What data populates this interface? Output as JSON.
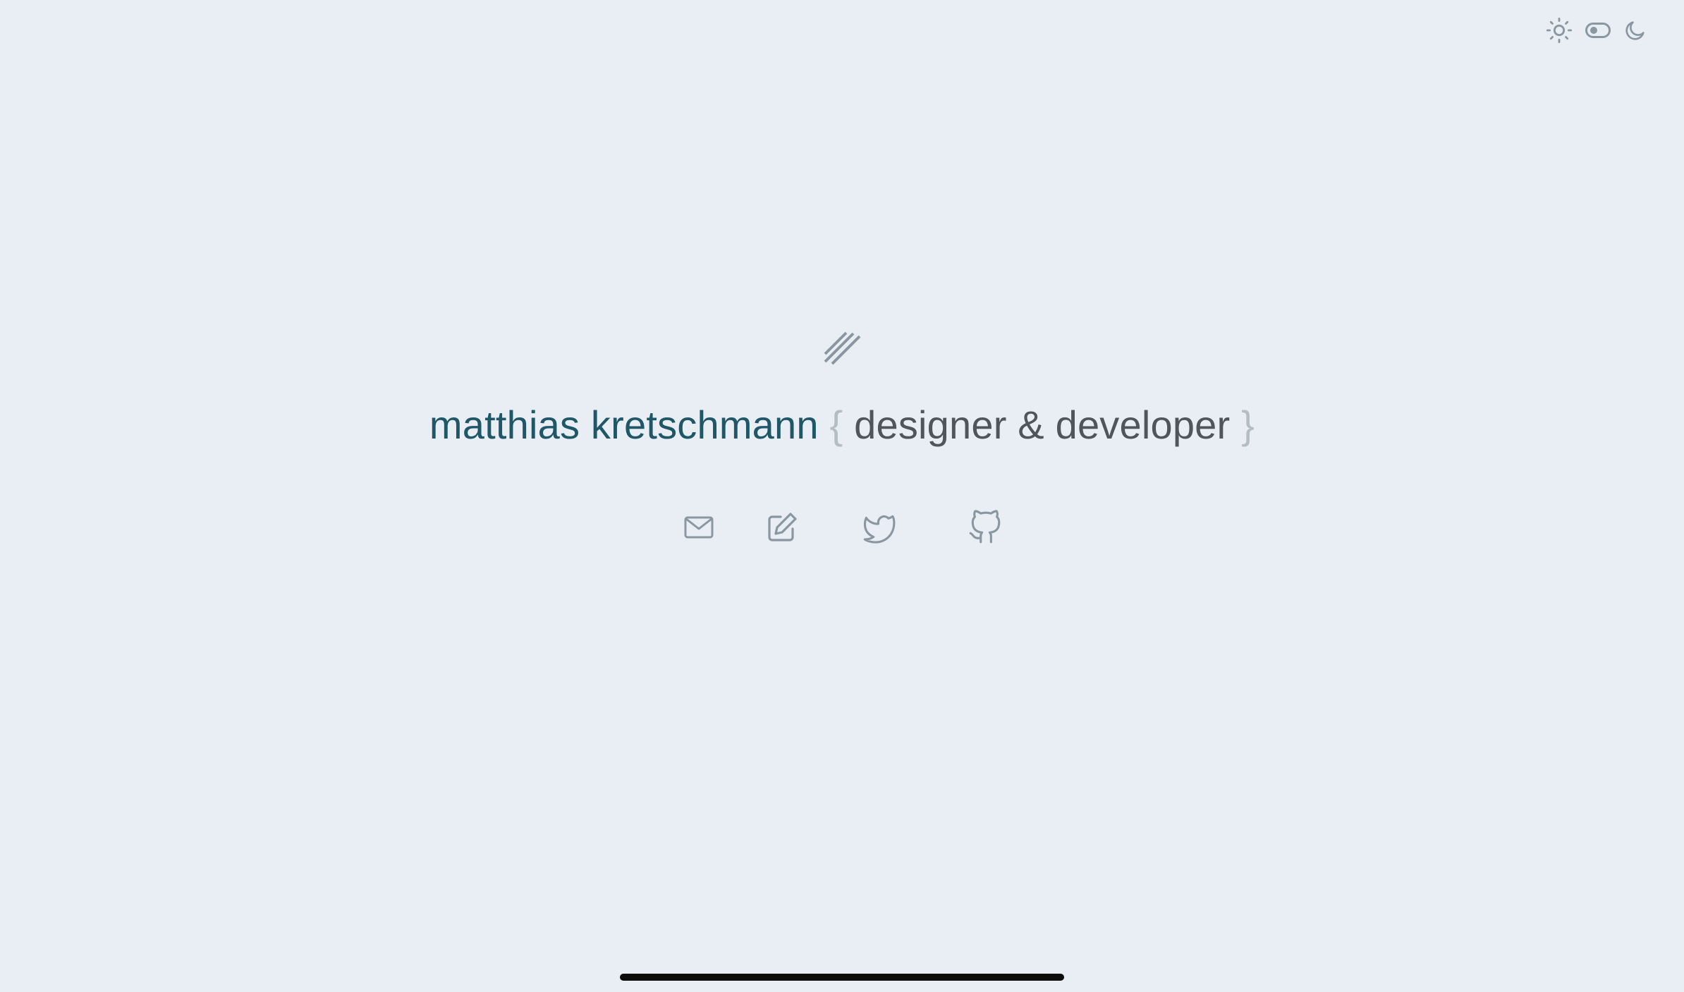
{
  "theme_switch": {
    "light_icon": "sun-icon",
    "toggle": "toggle-switch",
    "dark_icon": "moon-icon"
  },
  "logo": {
    "icon": "slashes-logo-icon"
  },
  "headline": {
    "name": "matthias kretschmann",
    "brace_open": "{",
    "role": "designer & developer",
    "brace_close": "}"
  },
  "links": [
    {
      "icon": "mail-icon"
    },
    {
      "icon": "edit-icon"
    },
    {
      "icon": "twitter-icon"
    },
    {
      "icon": "github-icon"
    }
  ],
  "colors": {
    "background": "#e9eef5",
    "name": "#1f5766",
    "role": "#4f555c",
    "brace": "#b4bcc4",
    "icon": "#8a96a0"
  }
}
